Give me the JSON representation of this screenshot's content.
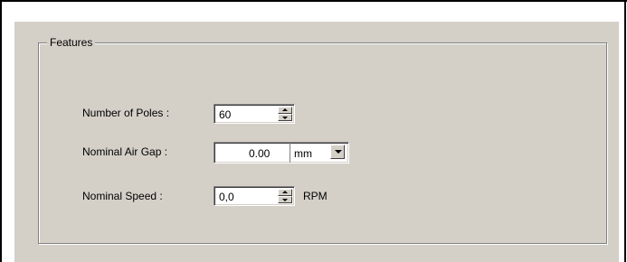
{
  "groupbox": {
    "title": "Features"
  },
  "poles": {
    "label": "Number of Poles :",
    "value": "60"
  },
  "airgap": {
    "label": "Nominal Air Gap :",
    "value": "0.00",
    "unit_selected": "mm"
  },
  "speed": {
    "label": "Nominal Speed :",
    "value": "0,0",
    "unit": "RPM"
  },
  "icons": {
    "spin_up": "triangle-up",
    "spin_down": "triangle-down",
    "dropdown": "triangle-down"
  }
}
